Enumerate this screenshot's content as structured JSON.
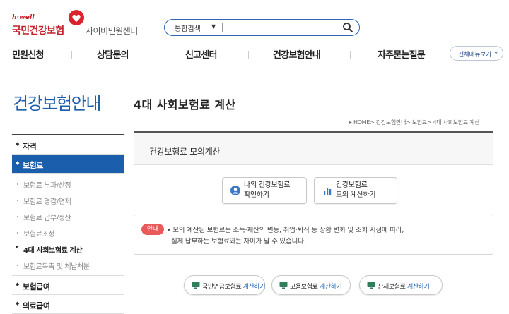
{
  "header": {
    "logo_small": "h·well",
    "logo_main": "국민건강보험",
    "logo_sub": "사이버민원센터",
    "search": {
      "select_label": "통합검색",
      "input_value": "",
      "placeholder": ""
    }
  },
  "gnb": {
    "items": [
      "민원신청",
      "상담문의",
      "신고센터",
      "건강보험안내",
      "자주묻는질문"
    ],
    "menu_all": "전체메뉴보기"
  },
  "lnb": {
    "title": "건강보험안내",
    "items": [
      {
        "label": "자격"
      },
      {
        "label": "보험료"
      },
      {
        "label": "보험급여"
      },
      {
        "label": "의료급여"
      }
    ],
    "sub_items": [
      "보험료 부과/산정",
      "보험료 경감/면제",
      "보험료 납부/정산",
      "보험료조정",
      "4대 사회보험료 계산",
      "보험료독촉 및 체납처분"
    ]
  },
  "content": {
    "page_title": "4대 사회보험료 계산",
    "breadcrumb": "HOME> 건강보험안내> 보험료> 4대 사회보험료 계산",
    "section_title": "건강보험료 모의계산",
    "sim_buttons": [
      {
        "line1": "나의 건강보험료",
        "line2": "확인하기",
        "icon": "user-icon"
      },
      {
        "line1": "건강보험료",
        "line2": "모의 계산하기",
        "icon": "bar-chart-icon"
      }
    ],
    "notice": {
      "badge": "안내",
      "line1": "• 모의 계산된 보험료는 소득·재산의 변동, 취업·퇴직 등 상황 변화 및 조회 시점에 따라,",
      "line2": "실제 납부하는 보험료와는 차이가 날 수 있습니다."
    },
    "calc_buttons": [
      {
        "name": "국민연금보험료",
        "action": "계산하기"
      },
      {
        "name": "고용보험료",
        "action": "계산하기"
      },
      {
        "name": "산재보험료",
        "action": "계산하기"
      }
    ]
  },
  "colors": {
    "brand_red": "#c41e2a",
    "brand_blue": "#1b5fac",
    "notice_badge": "#e95a5a"
  }
}
